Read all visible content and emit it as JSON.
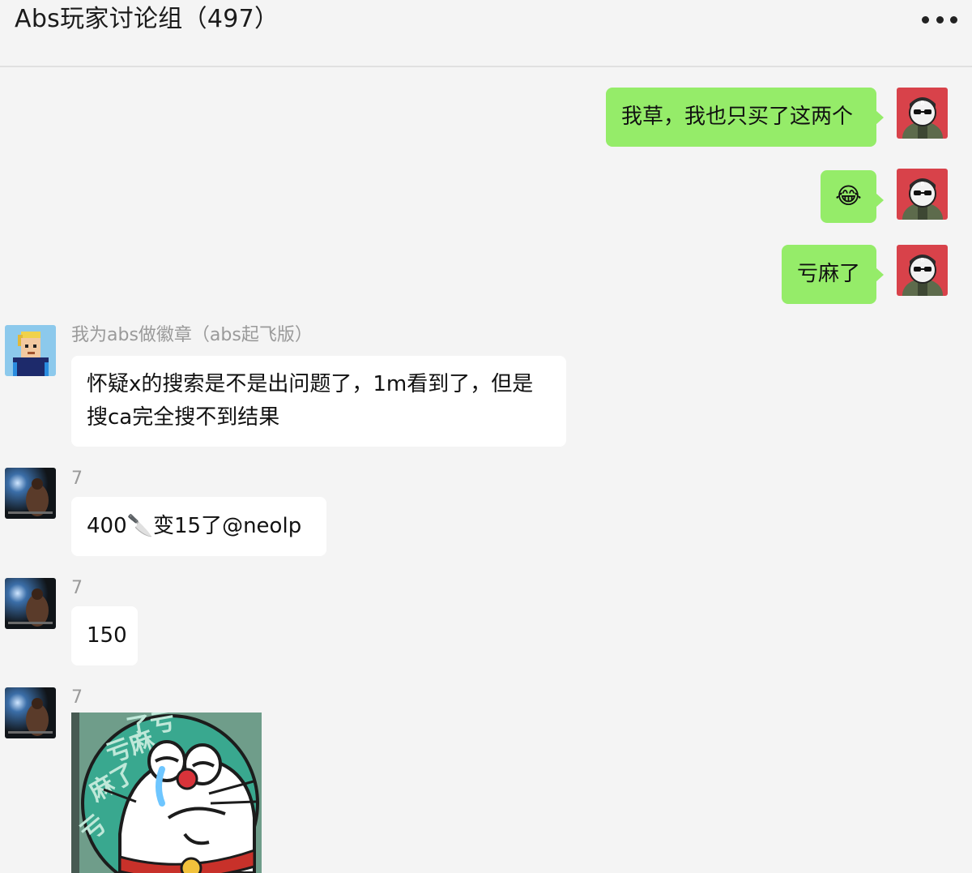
{
  "window": {
    "title": "Abs玩家讨论组（497）",
    "more_icon": "more-dots-icon"
  },
  "messages": [
    {
      "side": "me",
      "text": "我草，我也只买了这两个",
      "avatar": "avatar-self"
    },
    {
      "side": "me",
      "text": "😂",
      "avatar": "avatar-self"
    },
    {
      "side": "me",
      "text": "亏麻了",
      "avatar": "avatar-self"
    },
    {
      "side": "other",
      "sender": "我为abs做徽章（abs起飞版）",
      "text_line1": "怀疑x的搜索是不是出问题了，1m看到了，但是",
      "text_line2": "搜ca完全搜不到结果"
    },
    {
      "side": "other",
      "sender": "7",
      "text": "400🔪变15了@neolp"
    },
    {
      "side": "other",
      "sender": "7",
      "text": "150"
    },
    {
      "side": "other",
      "sender": "7",
      "image": "sticker-crying-cat-image",
      "sticker_text": "亏麻了"
    }
  ],
  "colors": {
    "background": "#f4f4f4",
    "self_bubble": "#95ec69",
    "other_bubble": "#ffffff",
    "sender_name": "#9a9a9a"
  }
}
